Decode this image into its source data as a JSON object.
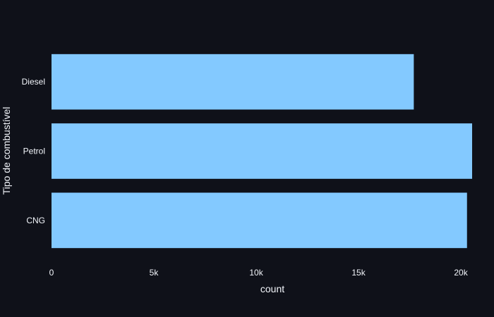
{
  "chart_data": {
    "type": "bar",
    "orientation": "horizontal",
    "categories": [
      "Diesel",
      "Petrol",
      "CNG"
    ],
    "values": [
      17700,
      20550,
      20300
    ],
    "xlabel": "count",
    "ylabel": "Tipo de combustível",
    "xlim": [
      0,
      20550
    ],
    "x_ticks": [
      0,
      5000,
      10000,
      15000,
      20000
    ],
    "x_tick_labels": [
      "0",
      "5k",
      "10k",
      "15k",
      "20k"
    ],
    "grid": false,
    "bar_color": "#83c9ff",
    "background_color": "#0f1119",
    "text_color": "#f2f5fa"
  }
}
